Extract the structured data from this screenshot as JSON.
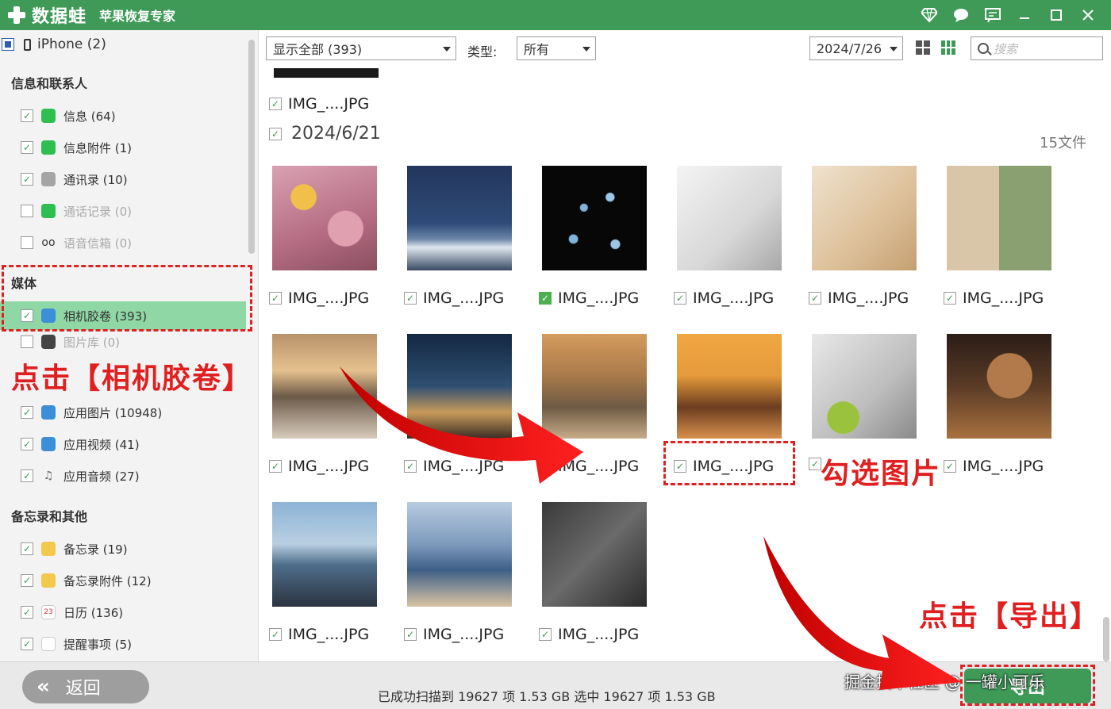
{
  "app": {
    "brand": "数据蛙",
    "product": "苹果恢复专家",
    "accent": "#3f9a58"
  },
  "sidebar": {
    "device": "iPhone (2)",
    "sections": [
      {
        "title": "信息和联系人",
        "items": [
          {
            "label": "信息 (64)",
            "checked": true,
            "icon": "message-icon"
          },
          {
            "label": "信息附件 (1)",
            "checked": true,
            "icon": "message-attachment-icon"
          },
          {
            "label": "通讯录 (10)",
            "checked": true,
            "icon": "contacts-icon"
          },
          {
            "label": "通话记录 (0)",
            "checked": false,
            "icon": "phone-icon"
          },
          {
            "label": "语音信箱 (0)",
            "checked": false,
            "icon": "voicemail-icon"
          }
        ]
      },
      {
        "title": "媒体",
        "items": [
          {
            "label": "相机胶卷 (393)",
            "checked": true,
            "icon": "camera-roll-icon"
          },
          {
            "label": "图片库 (0)",
            "checked": false,
            "icon": "photo-library-icon"
          },
          {
            "label": "应用图片 (10948)",
            "checked": true,
            "icon": "app-photos-icon"
          },
          {
            "label": "应用视频 (41)",
            "checked": true,
            "icon": "app-videos-icon"
          },
          {
            "label": "应用音频 (27)",
            "checked": true,
            "icon": "app-audio-icon"
          }
        ]
      },
      {
        "title": "备忘录和其他",
        "items": [
          {
            "label": "备忘录 (19)",
            "checked": true,
            "icon": "notes-icon"
          },
          {
            "label": "备忘录附件 (12)",
            "checked": true,
            "icon": "notes-attachment-icon"
          },
          {
            "label": "日历 (136)",
            "checked": true,
            "icon": "calendar-icon"
          },
          {
            "label": "提醒事项 (5)",
            "checked": true,
            "icon": "reminders-icon"
          }
        ]
      }
    ]
  },
  "toolbar": {
    "filter": "显示全部 (393)",
    "type_label": "类型:",
    "type_value": "所有",
    "date": "2024/7/26",
    "search_placeholder": "搜索"
  },
  "grid": {
    "prev_file": "IMG_....JPG",
    "date": "2024/6/21",
    "count": "15文件",
    "file_label": "IMG_....JPG"
  },
  "bottom": {
    "back": "返回",
    "status": "已成功扫描到 19627 项 1.53 GB  选中 19627 项 1.53 GB",
    "export": "导出"
  },
  "annotations": {
    "click_camera": "点击【相机胶卷】",
    "check_photos": "勾选图片",
    "click_export": "点击【导出】",
    "color": "#e02020"
  },
  "watermark": "掘金技术社区 @ 一罐小可乐"
}
